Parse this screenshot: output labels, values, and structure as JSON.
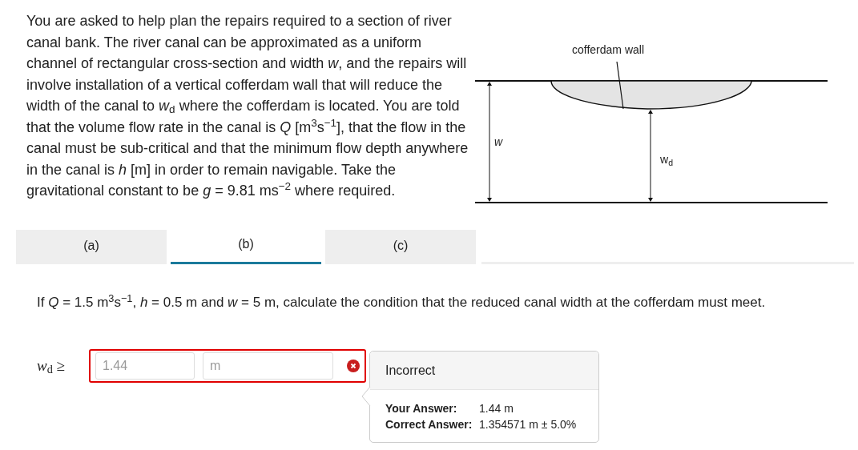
{
  "prompt": "You are asked to help plan the repairs required to a section of river canal bank. The river canal can be approximated as a uniform channel of rectangular cross-section and width *w*, and the repairs will involve installation of a vertical cofferdam wall that will reduce the width of the canal to *w*$_{d}$ where the cofferdam is located. You are told that the volume flow rate in the canal is *Q* [m$^{3}$s$^{−1}$], that the flow in the canal must be sub-critical and that the minimum flow depth anywhere in the canal is *h* [m] in order to remain navigable. Take the gravitational constant to be *g* = 9.81 ms$^{−2}$ where required.",
  "diagram": {
    "wall_label": "cofferdam wall",
    "width_label": "w",
    "reduced_width_label": "w$_{d}$"
  },
  "tabs": [
    {
      "label": "(a)",
      "selected": false
    },
    {
      "label": "(b)",
      "selected": true
    },
    {
      "label": "(c)",
      "selected": false
    }
  ],
  "question": "If *Q* = 1.5 m$^{3}$s$^{−1}$, *h* = 0.5 m and *w* = 5 m, calculate the condition that the reduced canal width at the cofferdam must meet.",
  "answer": {
    "label": "*w*$_{d}$ ≥",
    "value": "1.44",
    "unit": "m",
    "correct": false
  },
  "feedback": {
    "title": "Incorrect",
    "rows": [
      {
        "label": "Your Answer:",
        "value": "1.44 m"
      },
      {
        "label": "Correct Answer:",
        "value": "1.354571 m ± 5.0%"
      }
    ]
  }
}
